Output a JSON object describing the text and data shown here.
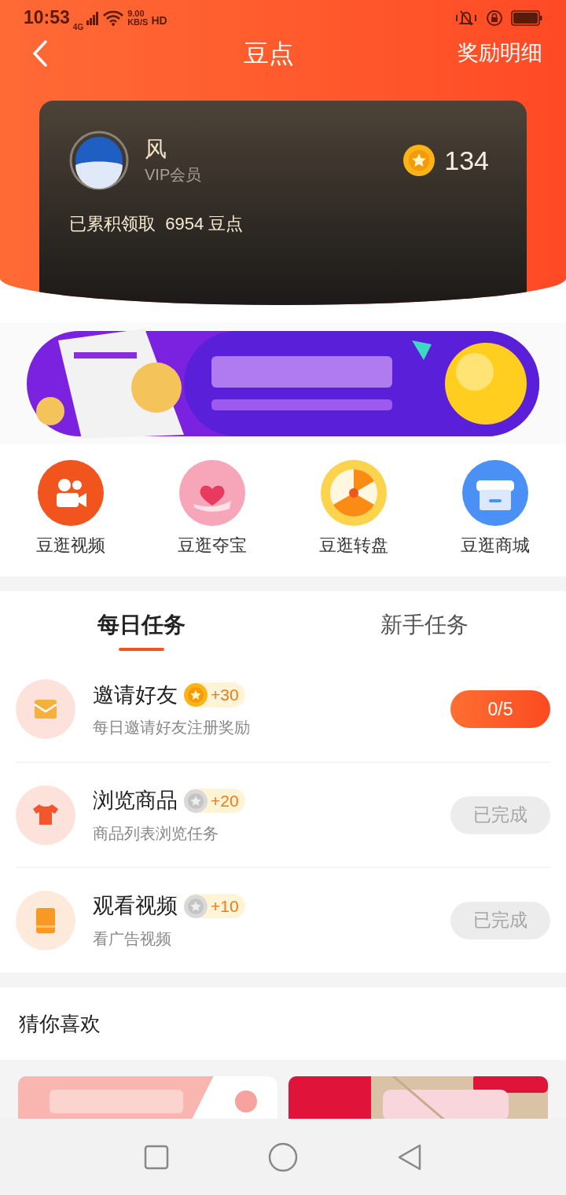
{
  "status_bar": {
    "time": "10:53",
    "network": "4G",
    "speed": "9.00",
    "speed_unit": "KB/S",
    "hd": "HD"
  },
  "nav": {
    "title": "豆点",
    "action": "奖励明细"
  },
  "account": {
    "name": "风",
    "level": "VIP会员",
    "points": "134",
    "total_prefix": "已累积领取",
    "total": "6954",
    "total_unit": "豆点"
  },
  "shortcuts": [
    {
      "label": "豆逛视频"
    },
    {
      "label": "豆逛夺宝"
    },
    {
      "label": "豆逛转盘"
    },
    {
      "label": "豆逛商城"
    }
  ],
  "tabs": [
    {
      "label": "每日任务",
      "selected": true
    },
    {
      "label": "新手任务",
      "selected": false
    }
  ],
  "tasks": [
    {
      "title": "邀请好友",
      "reward": "+30",
      "desc": "每日邀请好友注册奖励",
      "action": "0/5",
      "completed": false
    },
    {
      "title": "浏览商品",
      "reward": "+20",
      "desc": "商品列表浏览任务",
      "action": "已完成",
      "completed": true
    },
    {
      "title": "观看视频",
      "reward": "+10",
      "desc": "看广告视频",
      "action": "已完成",
      "completed": true
    }
  ],
  "recommend": {
    "title": "猜你喜欢"
  }
}
